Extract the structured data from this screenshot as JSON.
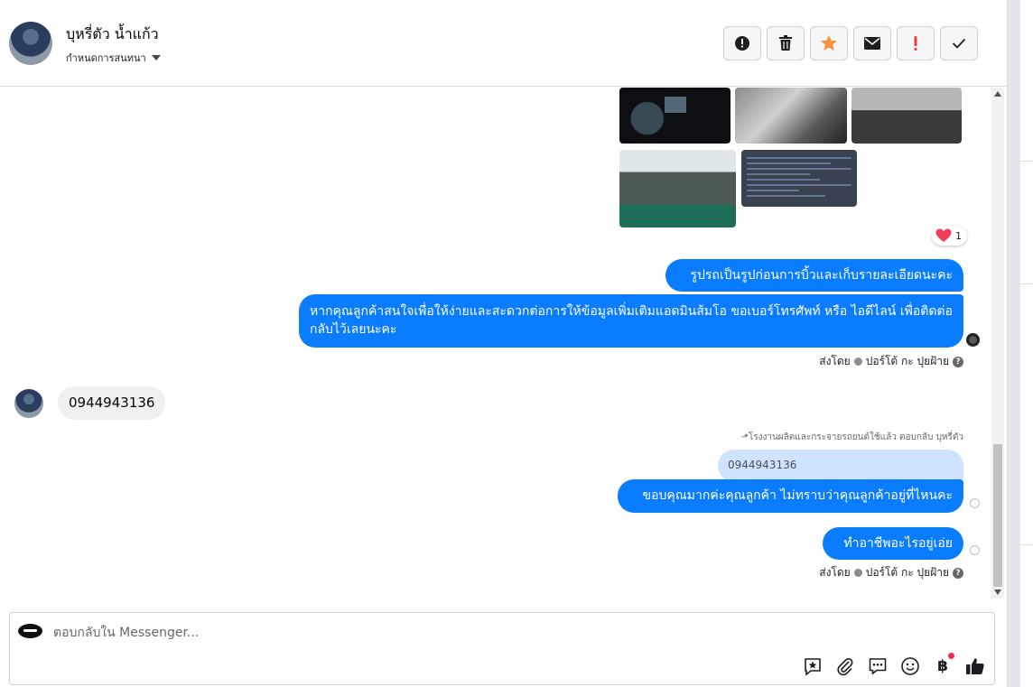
{
  "header": {
    "contact_name": "บุหรี่ตัว น้ำแก้ว",
    "assign_label": "กำหนดการสนทนา"
  },
  "toolbar": {
    "buttons": [
      {
        "icon": "alert-circle-icon",
        "label": "!"
      },
      {
        "icon": "trash-icon"
      },
      {
        "icon": "star-icon",
        "color": "#f7923b"
      },
      {
        "icon": "envelope-icon"
      },
      {
        "icon": "exclamation-icon",
        "label": "!",
        "color": "#fa383e"
      },
      {
        "icon": "checkmark-icon"
      }
    ]
  },
  "thread": {
    "reaction": {
      "emoji": "heart",
      "count": "1"
    },
    "messages": [
      {
        "direction": "outgoing",
        "text": "รูปรถเป็นรูปก่อนการบิ้วและเก็บรายละเอียดนะคะ"
      },
      {
        "direction": "outgoing",
        "text": "หากคุณลูกค้าสนใจเพื่อให้ง่ายและสะดวกต่อการให้ข้อมูลเพิ่มเติมแอดมินส้มโอ ขอเบอร์โทรศัพท์ หรือ ไอดีไลน์ เพื่อติดต่อกลับไว้เลยนะคะ"
      },
      {
        "direction": "incoming",
        "text": "0944943136"
      },
      {
        "direction": "outgoing",
        "text": "ขอบคุณมากค่ะคุณลูกค้า ไม่ทราบว่าคุณลูกค้าอยู่ที่ไหนคะ"
      },
      {
        "direction": "outgoing",
        "text": "ทำอาชีพอะไรอยู่เอ่ย"
      }
    ],
    "sent_by_label": "ส่งโดย",
    "sent_by_name": "ปอร์โต้ กะ ปุยฝ้าย",
    "reply_note": "โรงงานผลิตและกระจายรถยนต์ใช้แล้ว ตอบกลับ บุหรี่ตัว",
    "quoted_text": "0944943136"
  },
  "composer": {
    "placeholder": "ตอบกลับใน Messenger...",
    "icons": [
      "quick-reply-star-icon",
      "paperclip-icon",
      "saved-replies-icon",
      "emoji-icon",
      "baht-payment-icon",
      "thumbs-up-icon"
    ],
    "baht_symbol": "฿"
  },
  "colors": {
    "outgoing_bubble": "#0a7cff",
    "incoming_bubble": "#f0f0f0",
    "quoted_bubble": "#cfe3ff"
  }
}
